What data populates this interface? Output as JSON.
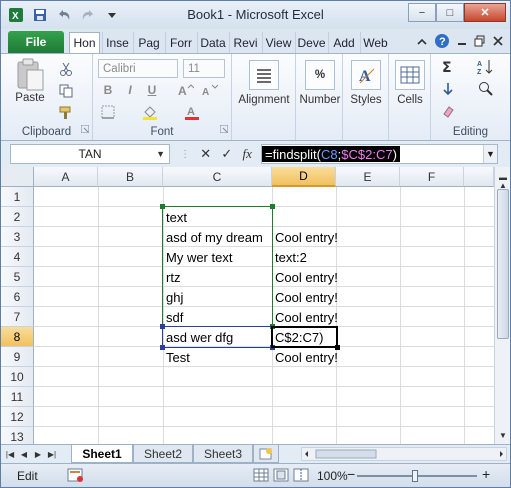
{
  "window": {
    "title": "Book1 - Microsoft Excel",
    "minimize": "−",
    "maximize": "□",
    "close": "✕"
  },
  "ribbon_tabs": {
    "file": "File",
    "items": [
      "Hon",
      "Inse",
      "Pag",
      "Forr",
      "Data",
      "Revi",
      "View",
      "Deve",
      "Add",
      "Web"
    ],
    "active_index": 0
  },
  "ribbon": {
    "clipboard": {
      "label": "Clipboard",
      "paste": "Paste"
    },
    "font": {
      "label": "Font",
      "font_name": "Calibri",
      "font_size": "11",
      "bold": "B",
      "italic": "I",
      "underline": "U"
    },
    "alignment": {
      "label": "Alignment"
    },
    "number": {
      "label": "Number",
      "symbol": "%"
    },
    "styles": {
      "label": "Styles"
    },
    "cells": {
      "label": "Cells"
    },
    "editing": {
      "label": "Editing"
    }
  },
  "formula_bar": {
    "name_box": "TAN",
    "cancel": "✕",
    "enter": "✓",
    "fx": "fx",
    "formula_prefix": "=findsplit(",
    "formula_arg1": "C8",
    "formula_sep": ";",
    "formula_arg2": "$C$2:C7",
    "formula_suffix": ")"
  },
  "sheet": {
    "columns": [
      "A",
      "B",
      "C",
      "D",
      "E",
      "F"
    ],
    "rows": [
      "1",
      "2",
      "3",
      "4",
      "5",
      "6",
      "7",
      "8",
      "9",
      "10",
      "11",
      "12",
      "13"
    ],
    "selected_column": "D",
    "selected_row": "8",
    "cells": {
      "C2": "text",
      "C3": "asd of my dream",
      "D3": "Cool entry!",
      "C4": "My wer text",
      "D4": "text:2",
      "C5": "rtz",
      "D5": "Cool entry!",
      "C6": "ghj",
      "D6": "Cool entry!",
      "C7": "sdf",
      "D7": "Cool entry!",
      "C8": "asd wer dfg",
      "D8": "C$2:C7)",
      "C9": "Test",
      "D9": "Cool entry!"
    }
  },
  "sheet_tabs": [
    "Sheet1",
    "Sheet2",
    "Sheet3"
  ],
  "active_sheet": "Sheet1",
  "status_bar": {
    "mode": "Edit",
    "zoom": "100%",
    "zoom_out": "−",
    "zoom_in": "+"
  },
  "colors": {
    "accent": "#217346",
    "formula_arg1": "#2b61d6",
    "formula_arg2": "#d94fd6",
    "active_header": "#f1c15f"
  }
}
